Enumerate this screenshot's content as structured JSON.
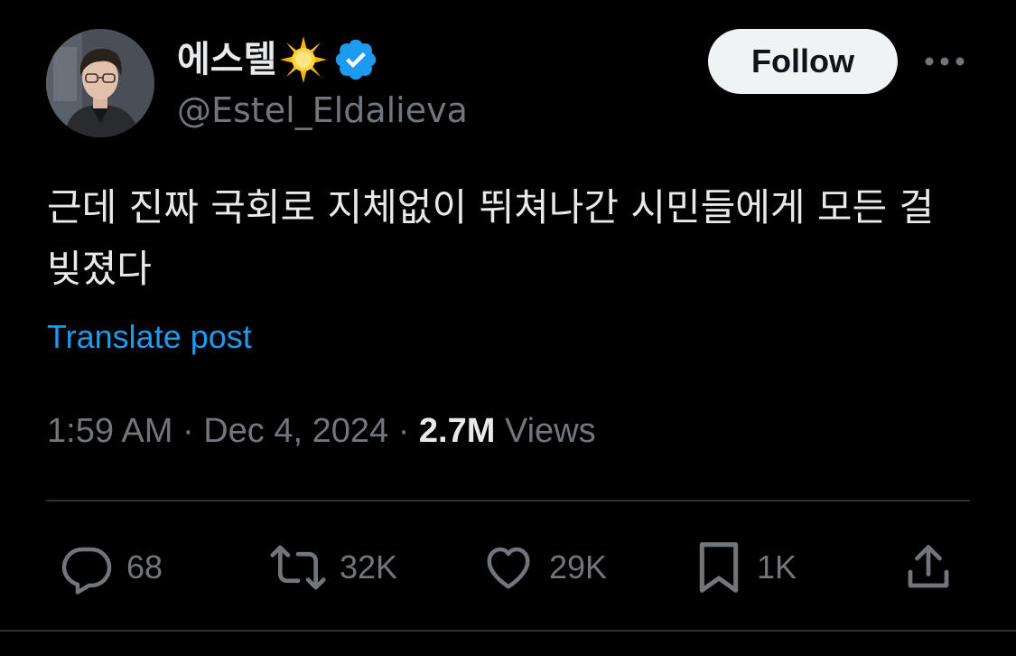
{
  "author": {
    "display_name": "에스텔",
    "name_emoji": "glowing-star-emoji",
    "verified_icon": "verified-badge-icon",
    "handle": "@Estel_Eldalieva"
  },
  "header": {
    "follow_label": "Follow",
    "more_icon": "more-horizontal-icon"
  },
  "post": {
    "text": "근데 진짜 국회로 지체없이 뛰쳐나간 시민들에게 모든 걸 빚졌다",
    "translate_label": "Translate post"
  },
  "meta": {
    "time": "1:59 AM",
    "separator": "·",
    "date": "Dec 4, 2024",
    "views_count": "2.7M",
    "views_label": "Views"
  },
  "actions": {
    "replies": {
      "icon": "reply-icon",
      "count": "68"
    },
    "reposts": {
      "icon": "repost-icon",
      "count": "32K"
    },
    "likes": {
      "icon": "heart-icon",
      "count": "29K"
    },
    "bookmarks": {
      "icon": "bookmark-icon",
      "count": "1K"
    },
    "share": {
      "icon": "share-icon"
    }
  },
  "colors": {
    "background": "#000000",
    "text_primary": "#e7e9ea",
    "text_secondary": "#71767b",
    "link": "#1d9bf0",
    "verified": "#1d9bf0",
    "divider": "#2f3336",
    "follow_bg": "#eff3f4"
  }
}
